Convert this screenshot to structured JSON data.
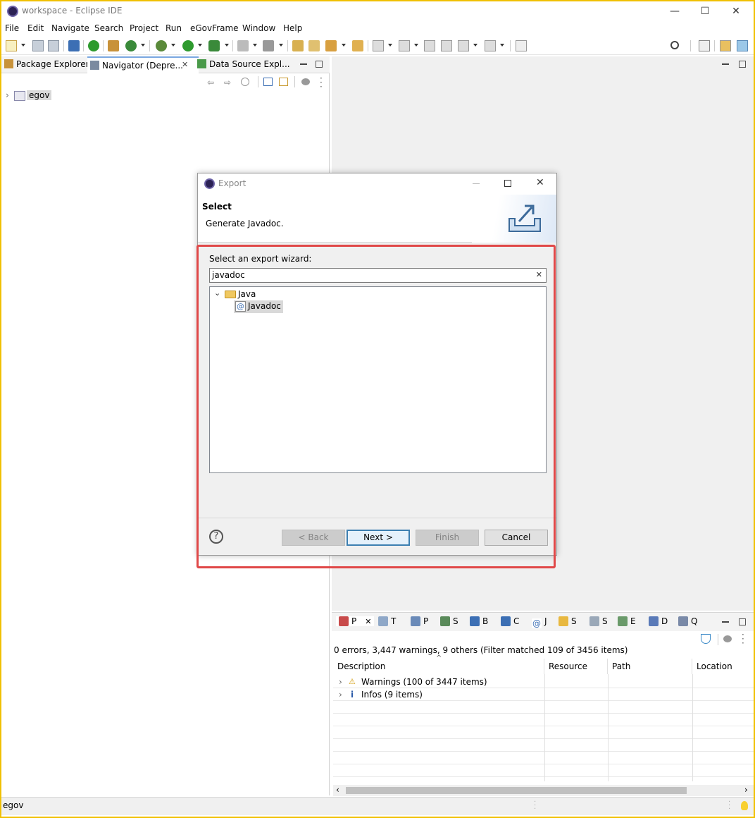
{
  "window": {
    "title": "workspace - Eclipse IDE",
    "minimize": "—",
    "maximize": "☐",
    "close": "✕"
  },
  "menubar": [
    "File",
    "Edit",
    "Navigate",
    "Search",
    "Project",
    "Run",
    "eGovFrame",
    "Window",
    "Help"
  ],
  "left_panel": {
    "tabs": [
      "Package Explorer",
      "Navigator (Depre...",
      "Data Source Expl..."
    ],
    "tree_item": "egov"
  },
  "dialog": {
    "title": "Export",
    "header_title": "Select",
    "header_desc": "Generate Javadoc.",
    "filter_label": "Select an export wizard:",
    "filter_value": "javadoc",
    "clear_icon": "✕",
    "tree": {
      "folder": "Java",
      "item": "Javadoc"
    },
    "help_icon": "?",
    "buttons": {
      "back": "< Back",
      "next": "Next >",
      "finish": "Finish",
      "cancel": "Cancel"
    }
  },
  "bottom_panel": {
    "tabs": [
      "P",
      "T",
      "P",
      "S",
      "B",
      "C",
      "J",
      "S",
      "S",
      "E",
      "D",
      "Q"
    ],
    "summary": "0 errors, 3,447 warnings, 9 others (Filter matched 109 of 3456 items)",
    "columns": [
      "Description",
      "Resource",
      "Path",
      "Location"
    ],
    "rows": [
      {
        "label": "Warnings (100 of 3447 items)",
        "icon": "warning-icon"
      },
      {
        "label": "Infos (9 items)",
        "icon": "info-icon"
      }
    ]
  },
  "status": {
    "text": "egov"
  },
  "colors": {
    "highlight_box": "#e04848",
    "window_border": "#f0c000",
    "default_button": "#3c7fb1"
  }
}
